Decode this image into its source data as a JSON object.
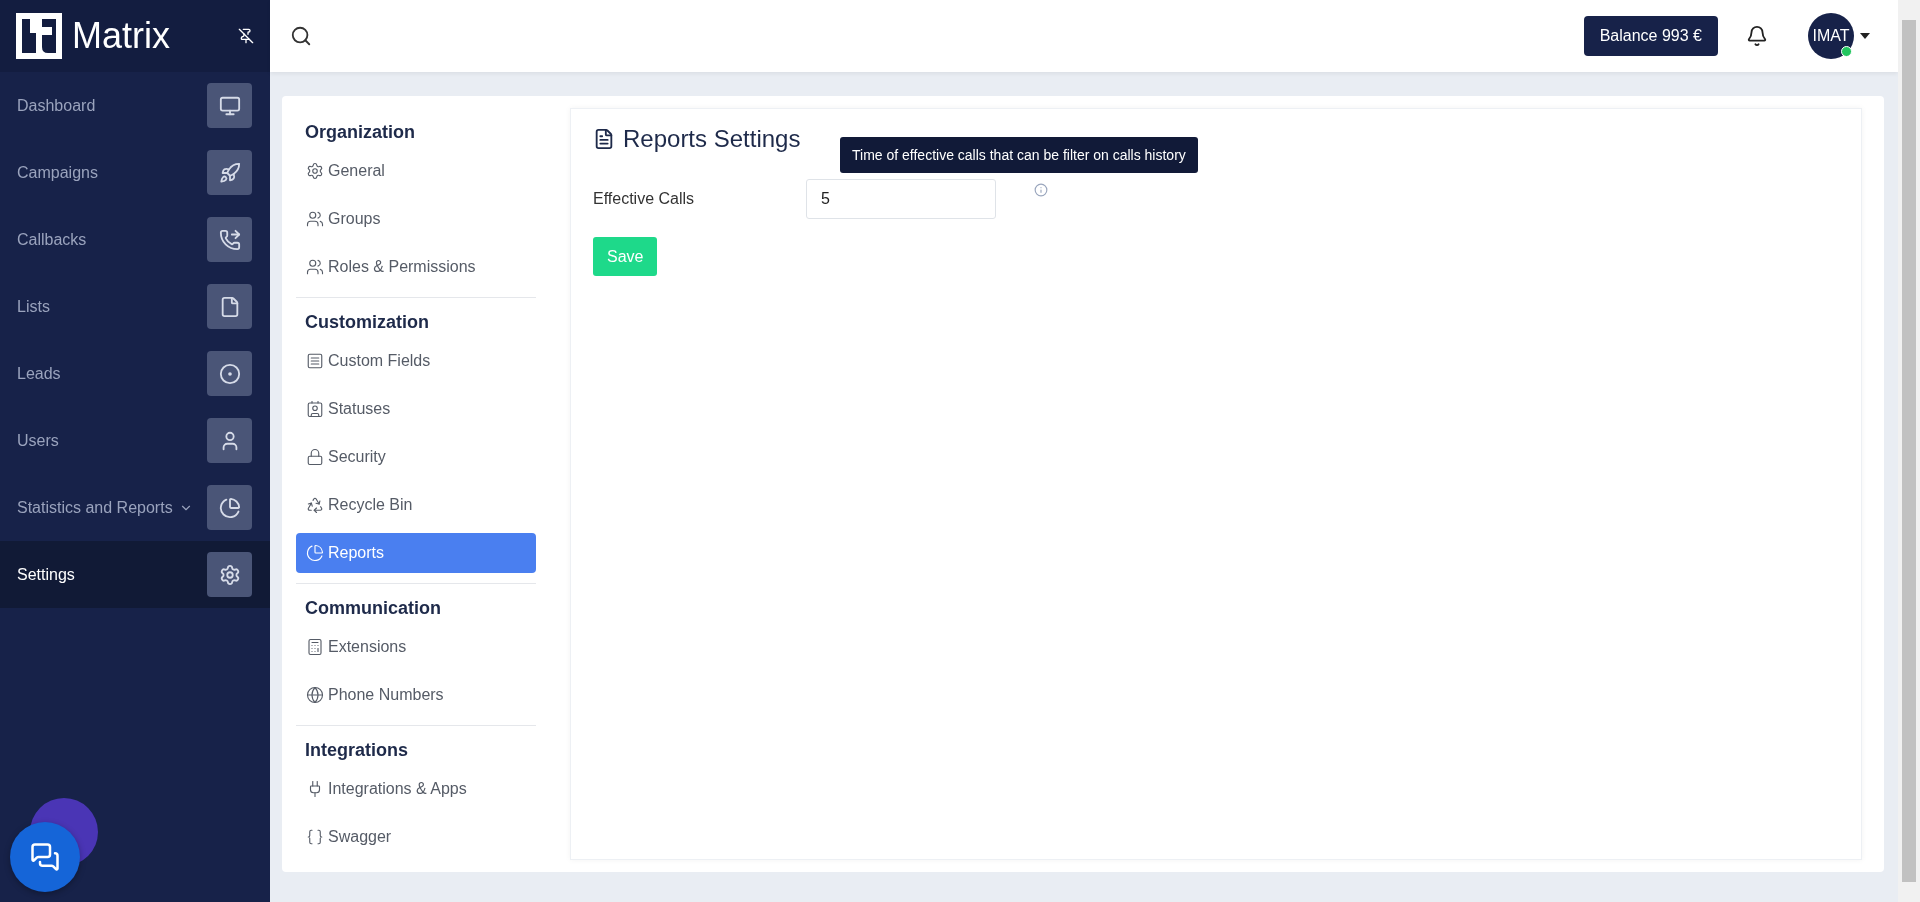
{
  "sidebar": {
    "logo": "Matrix",
    "items": [
      {
        "label": "Dashboard",
        "selected": false,
        "submenu": false
      },
      {
        "label": "Campaigns",
        "selected": false,
        "submenu": false
      },
      {
        "label": "Callbacks",
        "selected": false,
        "submenu": false
      },
      {
        "label": "Lists",
        "selected": false,
        "submenu": false
      },
      {
        "label": "Leads",
        "selected": false,
        "submenu": false
      },
      {
        "label": "Users",
        "selected": false,
        "submenu": false
      },
      {
        "label": "Statistics and Reports",
        "selected": false,
        "submenu": true
      },
      {
        "label": "Settings",
        "selected": true,
        "submenu": false
      }
    ]
  },
  "topbar": {
    "balance": "Balance 993 €",
    "avatar": "IMAT",
    "online": true
  },
  "settings_nav": [
    {
      "title": "Organization",
      "items": [
        {
          "label": "General",
          "selected": false
        },
        {
          "label": "Groups",
          "selected": false
        },
        {
          "label": "Roles & Permissions",
          "selected": false
        }
      ]
    },
    {
      "title": "Customization",
      "items": [
        {
          "label": "Custom Fields",
          "selected": false
        },
        {
          "label": "Statuses",
          "selected": false
        },
        {
          "label": "Security",
          "selected": false
        },
        {
          "label": "Recycle Bin",
          "selected": false
        },
        {
          "label": "Reports",
          "selected": true
        }
      ]
    },
    {
      "title": "Communication",
      "items": [
        {
          "label": "Extensions",
          "selected": false
        },
        {
          "label": "Phone Numbers",
          "selected": false
        }
      ]
    },
    {
      "title": "Integrations",
      "items": [
        {
          "label": "Integrations & Apps",
          "selected": false
        },
        {
          "label": "Swagger",
          "selected": false
        }
      ]
    }
  ],
  "content": {
    "title": "Reports Settings",
    "fields": [
      {
        "label": "Effective Calls",
        "value": "5",
        "tooltip": "Time of effective calls that can be filter on calls history"
      }
    ],
    "save": "Save"
  }
}
